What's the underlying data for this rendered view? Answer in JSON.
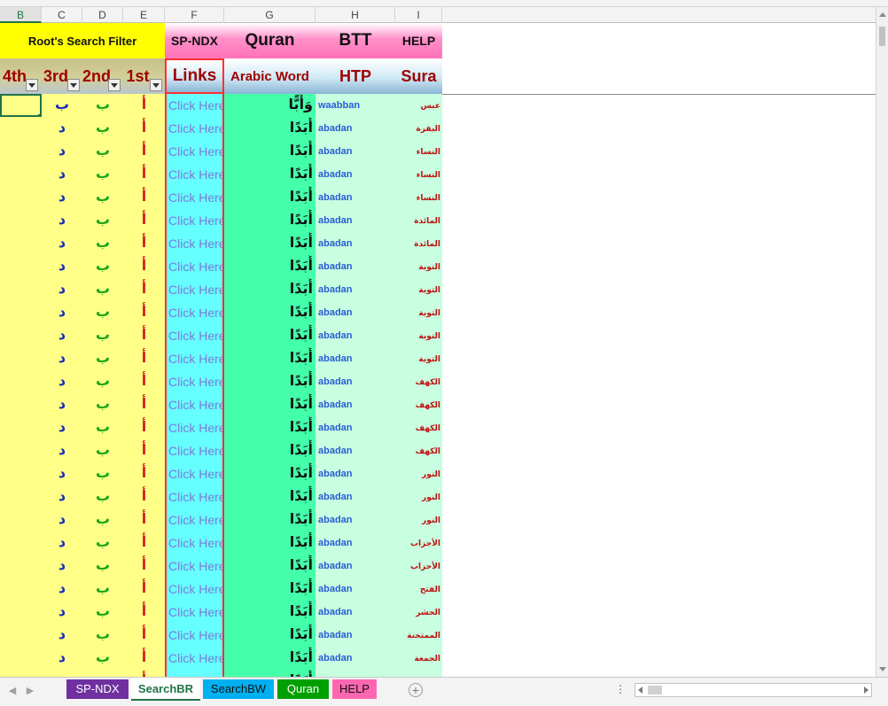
{
  "columns": [
    "B",
    "C",
    "D",
    "E",
    "F",
    "G",
    "H",
    "I"
  ],
  "header_row1": {
    "filter_title": "Root's Search Filter",
    "spndx": "SP-NDX",
    "quran": "Quran",
    "btt": "BTT",
    "help": "HELP"
  },
  "header_row2": {
    "fourth": "4th",
    "third": "3rd",
    "second": "2nd",
    "first": "1st",
    "links": "Links",
    "arabic_word": "Arabic Word",
    "htp": "HTP",
    "sura": "Sura"
  },
  "rows": [
    {
      "fourth": "",
      "third": "ب",
      "second": "ب",
      "first": "أ",
      "link": "Click Here",
      "arabic": "وَأَبًّا",
      "htp": "waabban",
      "sura": "عبس"
    },
    {
      "fourth": "",
      "third": "د",
      "second": "ب",
      "first": "أ",
      "link": "Click Here",
      "arabic": "أَبَدًا",
      "htp": "abadan",
      "sura": "البقرة"
    },
    {
      "fourth": "",
      "third": "د",
      "second": "ب",
      "first": "أ",
      "link": "Click Here",
      "arabic": "أَبَدًا",
      "htp": "abadan",
      "sura": "النساء"
    },
    {
      "fourth": "",
      "third": "د",
      "second": "ب",
      "first": "أ",
      "link": "Click Here",
      "arabic": "أَبَدًا",
      "htp": "abadan",
      "sura": "النساء"
    },
    {
      "fourth": "",
      "third": "د",
      "second": "ب",
      "first": "أ",
      "link": "Click Here",
      "arabic": "أَبَدًا",
      "htp": "abadan",
      "sura": "النساء"
    },
    {
      "fourth": "",
      "third": "د",
      "second": "ب",
      "first": "أ",
      "link": "Click Here",
      "arabic": "أَبَدًا",
      "htp": "abadan",
      "sura": "المائدة"
    },
    {
      "fourth": "",
      "third": "د",
      "second": "ب",
      "first": "أ",
      "link": "Click Here",
      "arabic": "أَبَدًا",
      "htp": "abadan",
      "sura": "المائدة"
    },
    {
      "fourth": "",
      "third": "د",
      "second": "ب",
      "first": "أ",
      "link": "Click Here",
      "arabic": "أَبَدًا",
      "htp": "abadan",
      "sura": "التوبة"
    },
    {
      "fourth": "",
      "third": "د",
      "second": "ب",
      "first": "أ",
      "link": "Click Here",
      "arabic": "أَبَدًا",
      "htp": "abadan",
      "sura": "التوبة"
    },
    {
      "fourth": "",
      "third": "د",
      "second": "ب",
      "first": "أ",
      "link": "Click Here",
      "arabic": "أَبَدًا",
      "htp": "abadan",
      "sura": "التوبة"
    },
    {
      "fourth": "",
      "third": "د",
      "second": "ب",
      "first": "أ",
      "link": "Click Here",
      "arabic": "أَبَدًا",
      "htp": "abadan",
      "sura": "التوبة"
    },
    {
      "fourth": "",
      "third": "د",
      "second": "ب",
      "first": "أ",
      "link": "Click Here",
      "arabic": "أَبَدًا",
      "htp": "abadan",
      "sura": "التوبة"
    },
    {
      "fourth": "",
      "third": "د",
      "second": "ب",
      "first": "أ",
      "link": "Click Here",
      "arabic": "أَبَدًا",
      "htp": "abadan",
      "sura": "الكهف"
    },
    {
      "fourth": "",
      "third": "د",
      "second": "ب",
      "first": "أ",
      "link": "Click Here",
      "arabic": "أَبَدًا",
      "htp": "abadan",
      "sura": "الكهف"
    },
    {
      "fourth": "",
      "third": "د",
      "second": "ب",
      "first": "أ",
      "link": "Click Here",
      "arabic": "أَبَدًا",
      "htp": "abadan",
      "sura": "الكهف"
    },
    {
      "fourth": "",
      "third": "د",
      "second": "ب",
      "first": "أ",
      "link": "Click Here",
      "arabic": "أَبَدًا",
      "htp": "abadan",
      "sura": "الكهف"
    },
    {
      "fourth": "",
      "third": "د",
      "second": "ب",
      "first": "أ",
      "link": "Click Here",
      "arabic": "أَبَدًا",
      "htp": "abadan",
      "sura": "النور"
    },
    {
      "fourth": "",
      "third": "د",
      "second": "ب",
      "first": "أ",
      "link": "Click Here",
      "arabic": "أَبَدًا",
      "htp": "abadan",
      "sura": "النور"
    },
    {
      "fourth": "",
      "third": "د",
      "second": "ب",
      "first": "أ",
      "link": "Click Here",
      "arabic": "أَبَدًا",
      "htp": "abadan",
      "sura": "النور"
    },
    {
      "fourth": "",
      "third": "د",
      "second": "ب",
      "first": "أ",
      "link": "Click Here",
      "arabic": "أَبَدًا",
      "htp": "abadan",
      "sura": "الأحزاب"
    },
    {
      "fourth": "",
      "third": "د",
      "second": "ب",
      "first": "أ",
      "link": "Click Here",
      "arabic": "أَبَدًا",
      "htp": "abadan",
      "sura": "الأحزاب"
    },
    {
      "fourth": "",
      "third": "د",
      "second": "ب",
      "first": "أ",
      "link": "Click Here",
      "arabic": "أَبَدًا",
      "htp": "abadan",
      "sura": "الفتح"
    },
    {
      "fourth": "",
      "third": "د",
      "second": "ب",
      "first": "أ",
      "link": "Click Here",
      "arabic": "أَبَدًا",
      "htp": "abadan",
      "sura": "الحشر"
    },
    {
      "fourth": "",
      "third": "د",
      "second": "ب",
      "first": "أ",
      "link": "Click Here",
      "arabic": "أَبَدًا",
      "htp": "abadan",
      "sura": "الممتحنة"
    },
    {
      "fourth": "",
      "third": "د",
      "second": "ب",
      "first": "أ",
      "link": "Click Here",
      "arabic": "أَبَدًا",
      "htp": "abadan",
      "sura": "الجمعة"
    },
    {
      "fourth": "",
      "third": "د",
      "second": "ب",
      "first": "أ",
      "link": "Click Here",
      "arabic": "أَبَدًا",
      "htp": "abadan",
      "sura": ""
    }
  ],
  "sheet_tabs": {
    "spndx": "SP-NDX",
    "searchbr": "SearchBR",
    "searchbw": "SearchBW",
    "quran": "Quran",
    "help": "HELP"
  },
  "icons": {
    "dropdown": "filter-dropdown-icon",
    "add_sheet": "plus-circle-icon",
    "nav_prev": "chevron-left-icon",
    "nav_next": "chevron-right-icon"
  }
}
